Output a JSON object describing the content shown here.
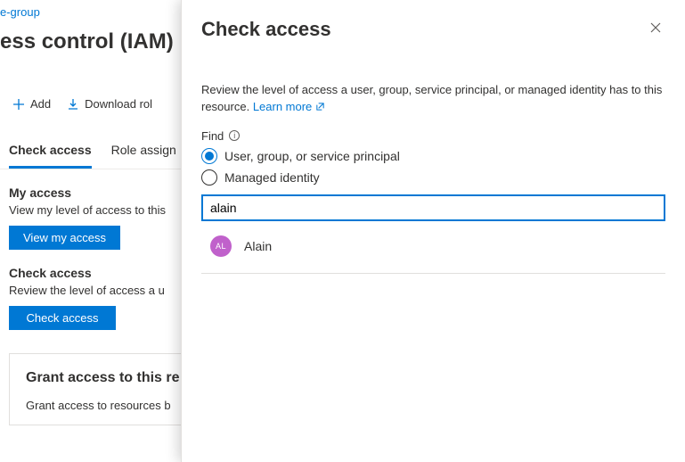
{
  "breadcrumb": "e-group",
  "page_title": "ess control (IAM)",
  "toolbar": {
    "add_label": "Add",
    "download_label": "Download rol"
  },
  "tabs": {
    "check_access": "Check access",
    "role_assign": "Role assign"
  },
  "my_access": {
    "heading": "My access",
    "desc": "View my level of access to this",
    "button": "View my access"
  },
  "check_access_section": {
    "heading": "Check access",
    "desc": "Review the level of access a u",
    "button": "Check access"
  },
  "grant_card": {
    "heading": "Grant access to this re",
    "desc": "Grant access to resources b"
  },
  "panel": {
    "title": "Check access",
    "desc": "Review the level of access a user, group, service principal, or managed identity has to this resource. ",
    "learn_more": "Learn more",
    "find_label": "Find",
    "radio_user": "User, group, or service principal",
    "radio_managed": "Managed identity",
    "search_value": "alain",
    "result": {
      "initials": "AL",
      "name": "Alain"
    }
  }
}
